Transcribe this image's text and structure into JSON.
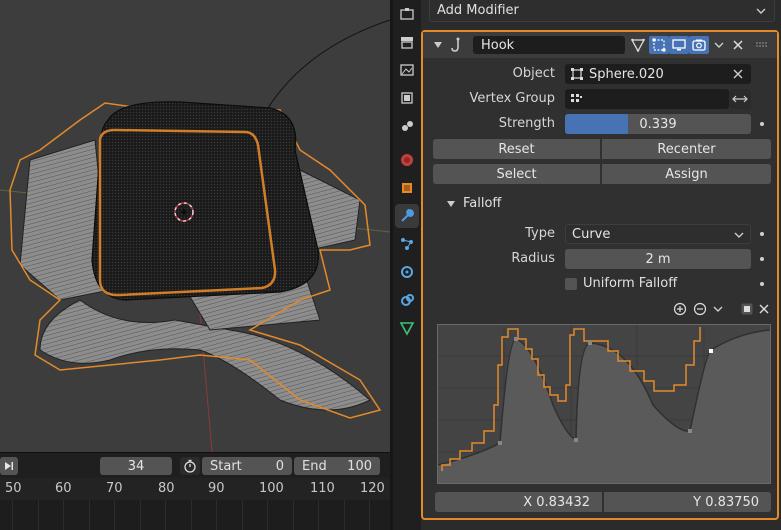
{
  "timeline": {
    "current_frame": "34",
    "start_label": "Start",
    "start_value": "0",
    "end_label": "End",
    "end_value": "100",
    "ruler_ticks": [
      "50",
      "60",
      "70",
      "80",
      "90",
      "100",
      "110",
      "120"
    ]
  },
  "properties_tabs": [
    "tool-icon",
    "render-icon",
    "output-icon",
    "view-layer-icon",
    "scene-icon",
    "world-icon",
    "object-icon",
    "modifier-icon",
    "particles-icon",
    "physics-icon",
    "constraints-icon",
    "data-icon",
    "material-icon"
  ],
  "add_modifier_label": "Add Modifier",
  "modifier": {
    "name": "Hook",
    "object_label": "Object",
    "object_value": "Sphere.020",
    "vertex_group_label": "Vertex Group",
    "vertex_group_value": "",
    "strength_label": "Strength",
    "strength_value": "0.339",
    "strength_fraction": 0.339,
    "reset_label": "Reset",
    "recenter_label": "Recenter",
    "select_label": "Select",
    "assign_label": "Assign",
    "falloff_label": "Falloff",
    "type_label": "Type",
    "type_value": "Curve",
    "radius_label": "Radius",
    "radius_value": "2 m",
    "uniform_falloff_label": "Uniform Falloff",
    "uniform_falloff_checked": false,
    "curve_x": "X 0.83432",
    "curve_y": "Y 0.83750"
  },
  "colors": {
    "accent": "#4772b3",
    "selection": "#e38a2a",
    "background": "#2b2b2b"
  }
}
